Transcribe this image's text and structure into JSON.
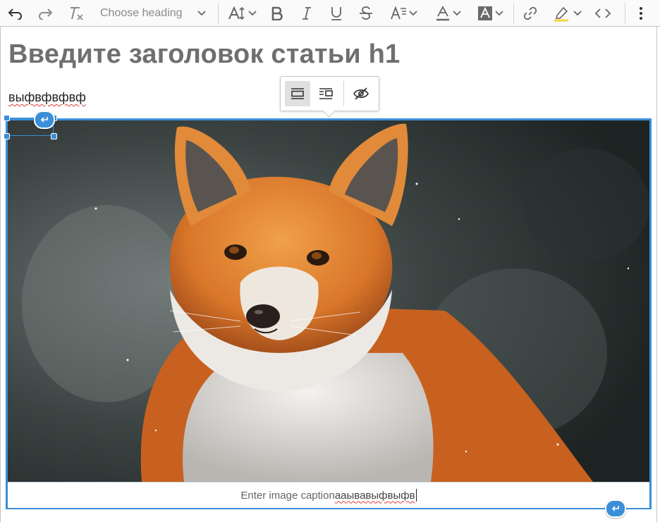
{
  "toolbar": {
    "heading_placeholder": "Choose heading",
    "buttons": [
      "undo-icon",
      "redo-icon",
      "remove-format-icon",
      "font-size-icon",
      "bold-icon",
      "italic-icon",
      "underline-icon",
      "strikethrough-icon",
      "font-family-icon",
      "font-color-icon",
      "background-color-icon",
      "link-icon",
      "highlight-icon",
      "source-code-icon",
      "more-icon"
    ]
  },
  "editor": {
    "title": "Введите заголовок статьи h1",
    "paragraph": "выфвфвфвф"
  },
  "image_toolbar": {
    "buttons": [
      "image-full-width-icon",
      "image-side-icon",
      "hide-caption-icon"
    ]
  },
  "figure": {
    "caption_placeholder": "Enter image caption",
    "caption_text": "аaывавыфвыфв"
  },
  "colors": {
    "accent": "#3a8fd8",
    "title": "#6f6f6f"
  }
}
